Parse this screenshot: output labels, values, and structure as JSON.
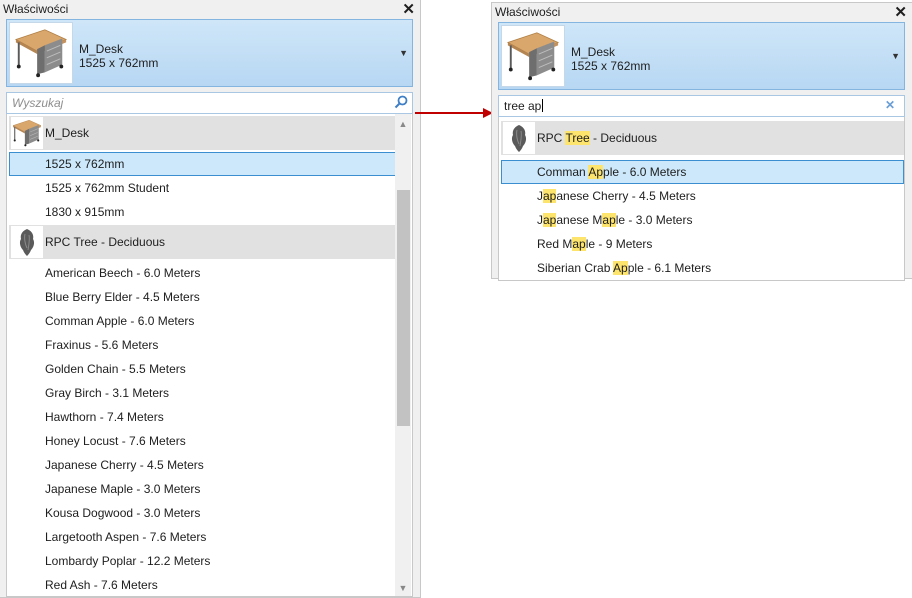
{
  "left": {
    "title": "Właściwości",
    "type_selector": {
      "family": "M_Desk",
      "size": "1525 x 762mm"
    },
    "search": {
      "placeholder": "Wyszukaj",
      "value": ""
    },
    "groups": [
      {
        "family": "M_Desk",
        "types": [
          "1525 x 762mm",
          "1525 x 762mm Student",
          "1830 x 915mm"
        ]
      },
      {
        "family": "RPC Tree - Deciduous",
        "types": [
          "American Beech - 6.0 Meters",
          "Blue Berry Elder - 4.5 Meters",
          "Comman Apple - 6.0 Meters",
          "Fraxinus - 5.6 Meters",
          "Golden Chain - 5.5 Meters",
          "Gray Birch - 3.1 Meters",
          "Hawthorn - 7.4 Meters",
          "Honey Locust - 7.6 Meters",
          "Japanese Cherry - 4.5 Meters",
          "Japanese Maple - 3.0 Meters",
          "Kousa Dogwood - 3.0 Meters",
          "Largetooth Aspen - 7.6 Meters",
          "Lombardy Poplar - 12.2 Meters",
          "Red Ash - 7.6 Meters"
        ]
      }
    ],
    "selected_type": "1525 x 762mm"
  },
  "right": {
    "title": "Właściwości",
    "type_selector": {
      "family": "M_Desk",
      "size": "1525 x 762mm"
    },
    "search": {
      "value": "tree ap"
    },
    "family_row": {
      "parts": [
        {
          "text": "RPC ",
          "hl": false
        },
        {
          "text": "Tree",
          "hl": true
        },
        {
          "text": " - Deciduous",
          "hl": false
        }
      ]
    },
    "results": [
      {
        "parts": [
          {
            "text": "Comman ",
            "hl": false
          },
          {
            "text": "Ap",
            "hl": true
          },
          {
            "text": "ple - 6.0 Meters",
            "hl": false
          }
        ],
        "selected": true
      },
      {
        "parts": [
          {
            "text": "J",
            "hl": false
          },
          {
            "text": "ap",
            "hl": true
          },
          {
            "text": "anese Cherry - 4.5 Meters",
            "hl": false
          }
        ],
        "selected": false
      },
      {
        "parts": [
          {
            "text": "J",
            "hl": false
          },
          {
            "text": "ap",
            "hl": true
          },
          {
            "text": "anese M",
            "hl": false
          },
          {
            "text": "ap",
            "hl": true
          },
          {
            "text": "le - 3.0 Meters",
            "hl": false
          }
        ],
        "selected": false
      },
      {
        "parts": [
          {
            "text": "Red M",
            "hl": false
          },
          {
            "text": "ap",
            "hl": true
          },
          {
            "text": "le - 9 Meters",
            "hl": false
          }
        ],
        "selected": false
      },
      {
        "parts": [
          {
            "text": "Siberian Crab ",
            "hl": false
          },
          {
            "text": "Ap",
            "hl": true
          },
          {
            "text": "ple - 6.1 Meters",
            "hl": false
          }
        ],
        "selected": false
      }
    ]
  },
  "colors": {
    "highlight": "#fde46c",
    "selection_fill": "#cce8fa",
    "selection_border": "#3b8fd0",
    "arrow": "#c00000"
  }
}
